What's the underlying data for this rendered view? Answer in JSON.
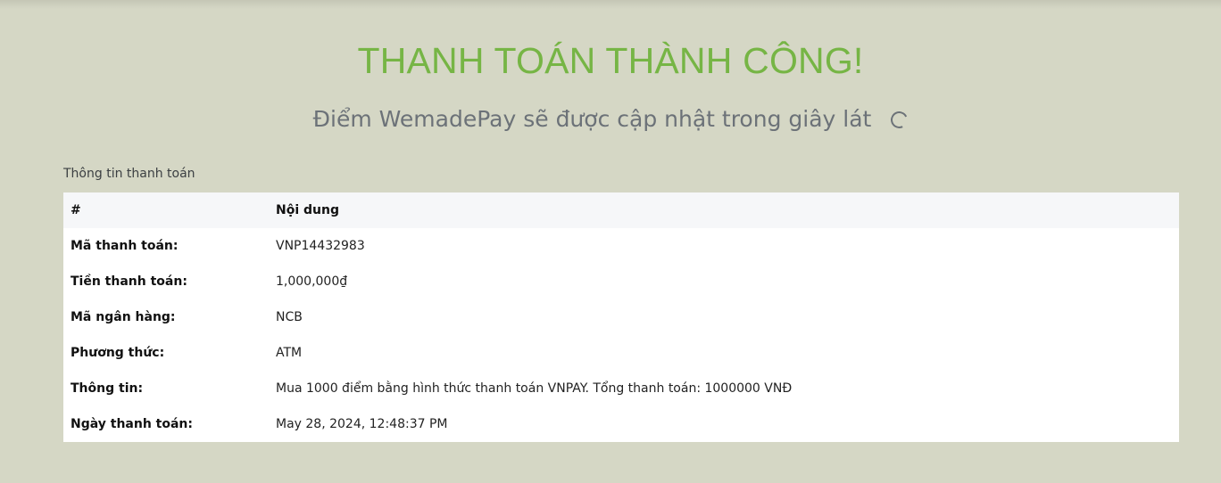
{
  "header": {
    "title": "THANH TOÁN THÀNH CÔNG!",
    "subtitle": "Điểm WemadePay sẽ được cập nhật trong giây lát",
    "loading_icon": "spinner-icon"
  },
  "section": {
    "label": "Thông tin thanh toán"
  },
  "table": {
    "headers": [
      "#",
      "Nội dung"
    ],
    "rows": [
      {
        "key": "Mã thanh toán:",
        "value": "VNP14432983"
      },
      {
        "key": "Tiền thanh toán:",
        "value": "1,000,000₫"
      },
      {
        "key": "Mã ngân hàng:",
        "value": "NCB"
      },
      {
        "key": "Phương thức:",
        "value": "ATM"
      },
      {
        "key": "Thông tin:",
        "value": "Mua 1000 điểm bằng hình thức thanh toán VNPAY. Tổng thanh toán: 1000000 VNĐ"
      },
      {
        "key": "Ngày thanh toán:",
        "value": "May 28, 2024, 12:48:37 PM"
      }
    ]
  },
  "colors": {
    "background": "#d5d7c5",
    "title": "#76b545",
    "subtitle": "#6c7278",
    "table_header_bg": "#f6f7f9",
    "table_bg": "#ffffff"
  }
}
